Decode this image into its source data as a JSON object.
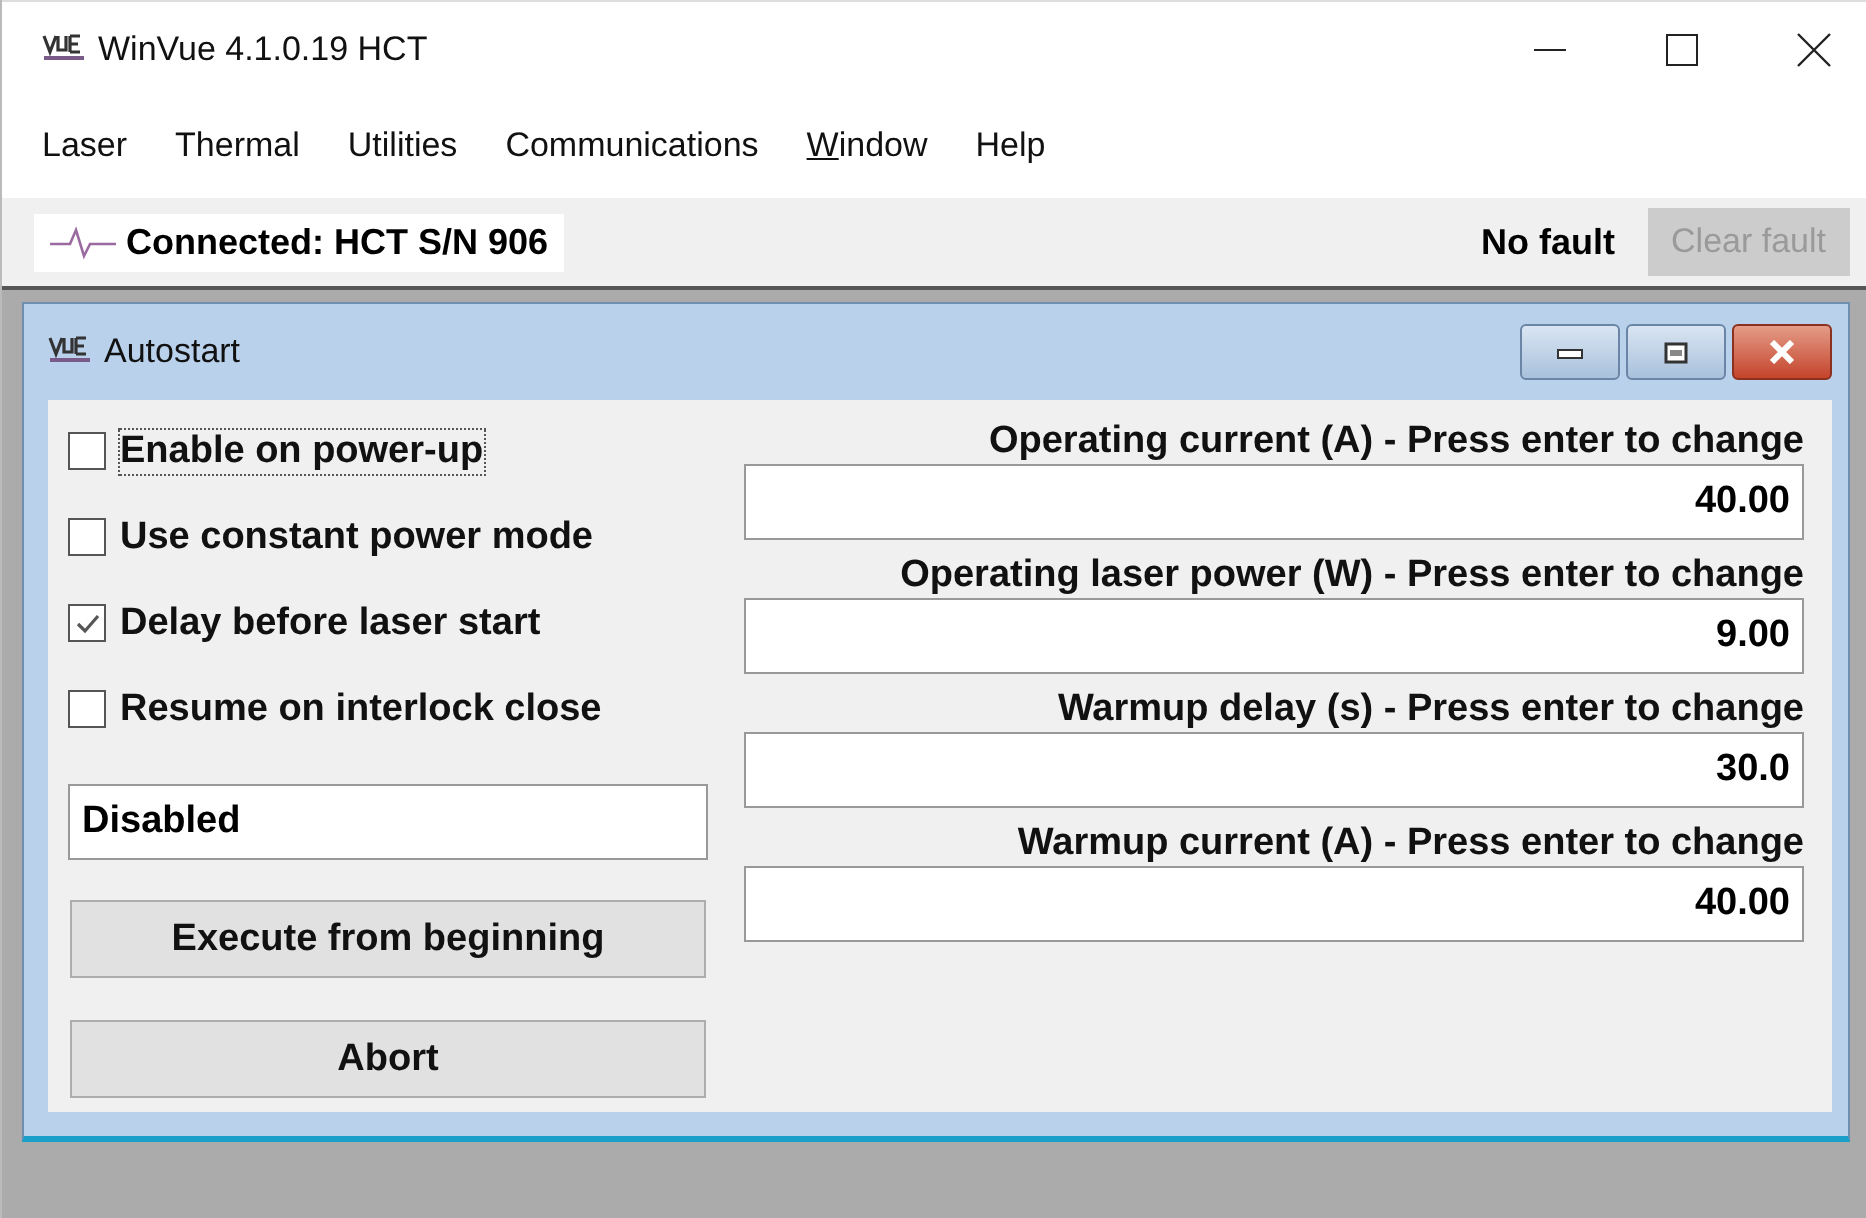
{
  "window": {
    "title": "WinVue 4.1.0.19 HCT"
  },
  "menu": [
    {
      "label": "Laser",
      "underline_first": false
    },
    {
      "label": "Thermal",
      "underline_first": false
    },
    {
      "label": "Utilities",
      "underline_first": false
    },
    {
      "label": "Communications",
      "underline_first": false
    },
    {
      "label": "Window",
      "underline_first": true
    },
    {
      "label": "Help",
      "underline_first": false
    }
  ],
  "toolbar": {
    "connection": "Connected: HCT S/N 906",
    "fault_status": "No fault",
    "clear_fault": {
      "label": "Clear fault",
      "disabled": true
    }
  },
  "child_window": {
    "title": "Autostart",
    "options": [
      {
        "label": "Enable on power-up",
        "checked": false,
        "focused": true
      },
      {
        "label": "Use constant power mode",
        "checked": false,
        "focused": false
      },
      {
        "label": "Delay before laser start",
        "checked": true,
        "focused": false
      },
      {
        "label": "Resume on interlock close",
        "checked": false,
        "focused": false
      }
    ],
    "status_field": {
      "value": "Disabled"
    },
    "buttons": [
      "Execute from beginning",
      "Abort"
    ],
    "settings": [
      {
        "label": "Operating current (A) - Press enter to change",
        "value": "40.00"
      },
      {
        "label": "Operating laser power (W) - Press enter to change",
        "value": "9.00"
      },
      {
        "label": "Warmup delay (s) - Press enter to change",
        "value": "30.0"
      },
      {
        "label": "Warmup current (A) - Press enter to change",
        "value": "40.00"
      }
    ]
  }
}
